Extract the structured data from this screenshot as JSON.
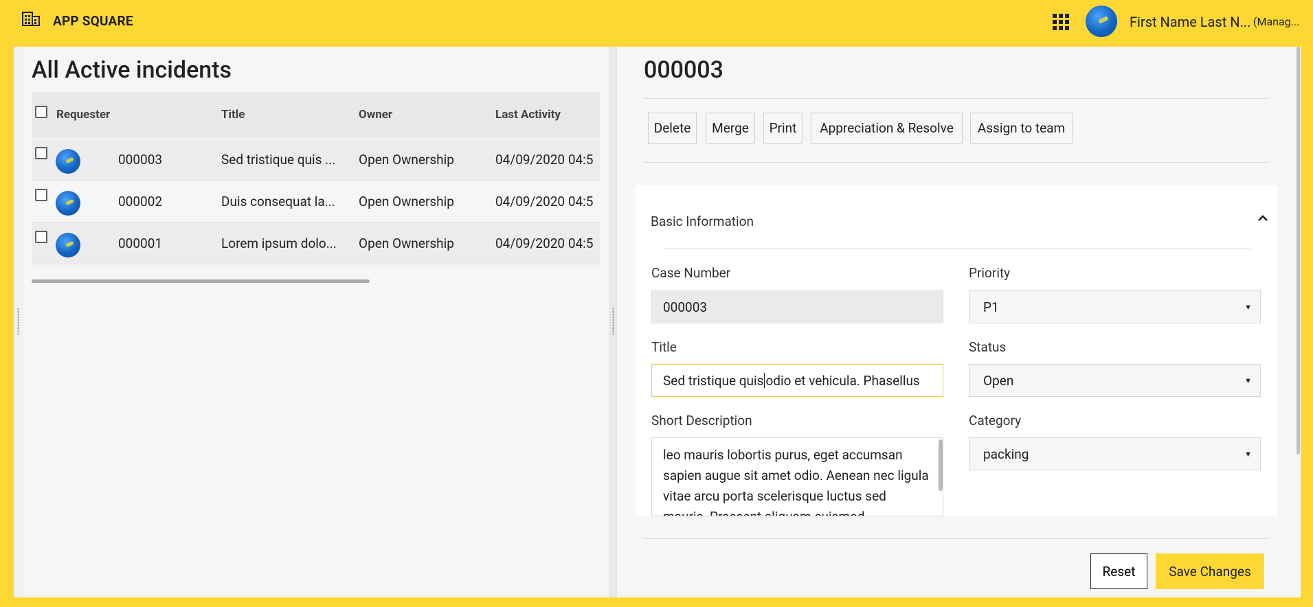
{
  "app": {
    "title": "APP SQUARE"
  },
  "user": {
    "name": "First Name Last N...",
    "role": "(Manag..."
  },
  "list": {
    "title": "All Active incidents",
    "columns": [
      "Requester",
      "Title",
      "Owner",
      "Last Activity"
    ],
    "rows": [
      {
        "id": "000003",
        "title": "Sed tristique quis ...",
        "owner": "Open Ownership",
        "last_activity": "04/09/2020 04:5"
      },
      {
        "id": "000002",
        "title": "Duis consequat la...",
        "owner": "Open Ownership",
        "last_activity": "04/09/2020 04:5"
      },
      {
        "id": "000001",
        "title": "Lorem ipsum dolo...",
        "owner": "Open Ownership",
        "last_activity": "04/09/2020 04:5"
      }
    ]
  },
  "detail": {
    "title": "000003",
    "actions": {
      "delete": "Delete",
      "merge": "Merge",
      "print": "Print",
      "appreciate": "Appreciation & Resolve",
      "assign": "Assign to team"
    },
    "section_title": "Basic Information",
    "fields": {
      "case_number": {
        "label": "Case Number",
        "value": "000003"
      },
      "priority": {
        "label": "Priority",
        "value": "P1"
      },
      "title": {
        "label": "Title",
        "value_before": "Sed tristique quis ",
        "value_after": "odio et vehicula. Phasellus"
      },
      "status": {
        "label": "Status",
        "value": "Open"
      },
      "short_description": {
        "label": "Short Description",
        "value": "leo mauris lobortis purus, eget accumsan sapien augue sit amet odio. Aenean nec ligula vitae arcu porta scelerisque luctus sed mauris. Praesent aliquam euismod"
      },
      "category": {
        "label": "Category",
        "value": "packing"
      }
    },
    "footer": {
      "reset": "Reset",
      "save": "Save Changes"
    }
  },
  "icons": {
    "logo": "building-icon",
    "apps": "apps-grid-icon",
    "collapse": "chevron-up-icon",
    "select": "caret-down-icon"
  },
  "colors": {
    "accent": "#fdd835",
    "focus_border": "#f3c64e"
  }
}
